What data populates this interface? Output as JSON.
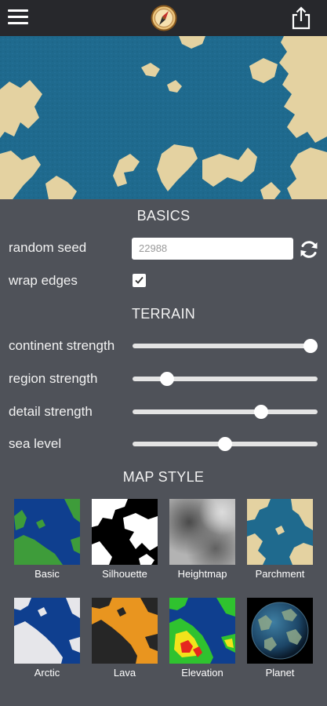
{
  "toolbar": {
    "menu_icon": "hamburger-menu-icon",
    "logo_icon": "compass-icon",
    "share_icon": "share-icon"
  },
  "basics": {
    "title": "BASICS",
    "seed_label": "random seed",
    "seed_value": "22988",
    "refresh_icon": "refresh-icon",
    "wrap_label": "wrap edges",
    "wrap_checked": true
  },
  "terrain": {
    "title": "TERRAIN",
    "sliders": [
      {
        "label": "continent strength",
        "value": 1.0
      },
      {
        "label": "region strength",
        "value": 0.16
      },
      {
        "label": "detail strength",
        "value": 0.71
      },
      {
        "label": "sea level",
        "value": 0.5
      }
    ]
  },
  "map_style": {
    "title": "MAP STYLE",
    "styles": [
      {
        "label": "Basic"
      },
      {
        "label": "Silhouette"
      },
      {
        "label": "Heightmap"
      },
      {
        "label": "Parchment"
      },
      {
        "label": "Arctic"
      },
      {
        "label": "Lava"
      },
      {
        "label": "Elevation"
      },
      {
        "label": "Planet"
      }
    ]
  },
  "colors": {
    "panel": "#4f5259",
    "topbar": "#27282c",
    "sea": "#1f6a8e",
    "land": "#e4d2a1",
    "basic_sea": "#0f3f8f",
    "basic_land": "#3e9c3a",
    "lava": "#e9951f"
  }
}
